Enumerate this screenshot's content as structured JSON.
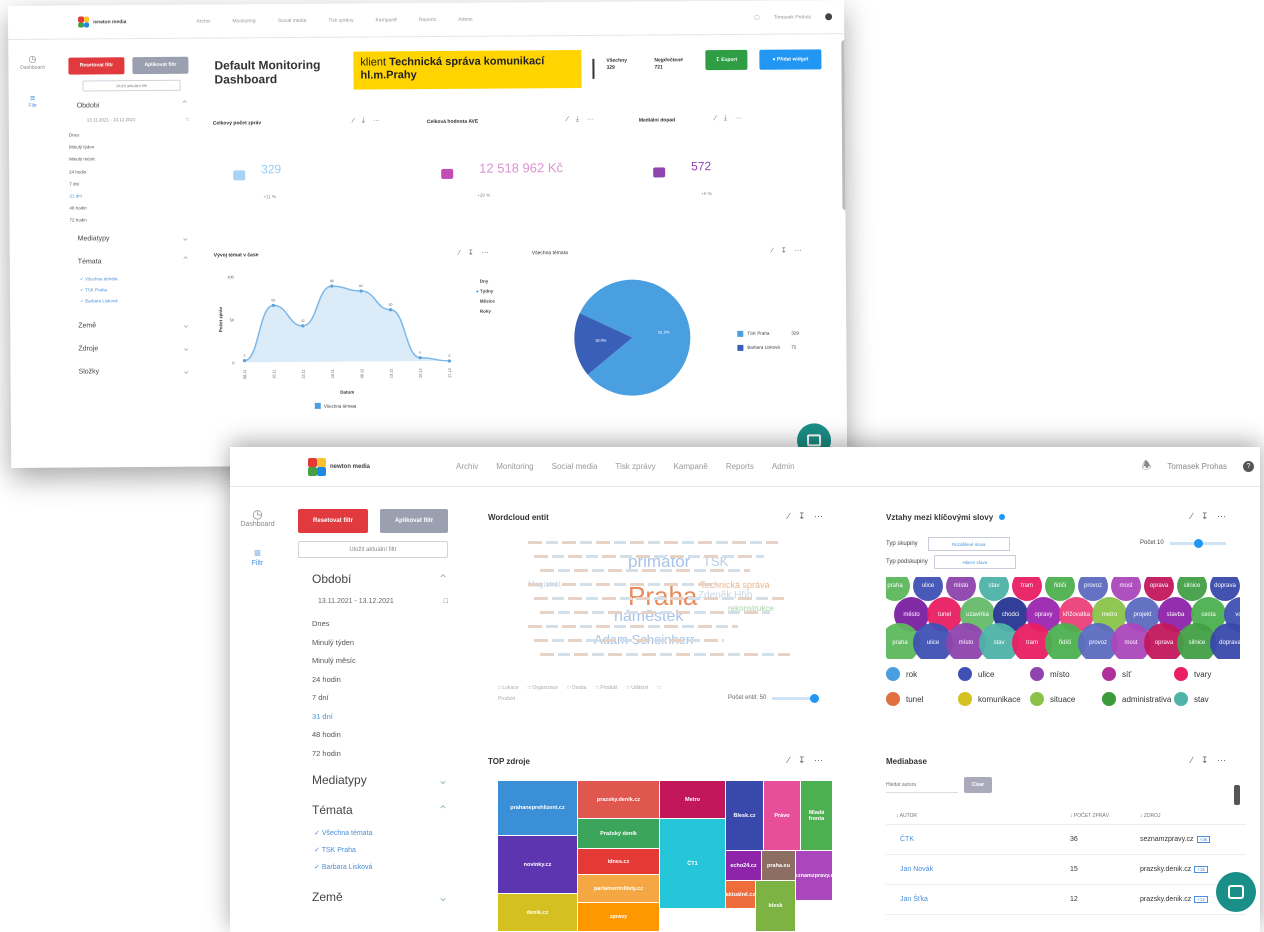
{
  "colors": {
    "accent": "#2196f3",
    "red": "#e03a3e",
    "green": "#2e9d44",
    "banner": "#ffd400",
    "teal": "#1a8f87"
  },
  "app": {
    "logo_text": "newton media",
    "nav": [
      "Archiv",
      "Monitoring",
      "Social media",
      "Tisk zprávy",
      "Kampaně",
      "Reports",
      "Admin"
    ],
    "user": "Tomasek Prohas",
    "settings_icon": "gear-icon",
    "bell_icon": "bell-icon"
  },
  "sidebar": {
    "dashboard_label": "Dashboard",
    "filter_label": "Filtr",
    "reset_filter": "Resetovat filtr",
    "apply_filter": "Aplikovat filtr",
    "save_filter": "Uložit aktuální filtr",
    "period_label": "Období",
    "date_range": "13.11.2021 - 13.12.2021",
    "period_options": [
      "Dnes",
      "Minulý týden",
      "Minulý měsíc",
      "24 hodin",
      "7 dní",
      "31 dní",
      "48 hodin",
      "72 hodin"
    ],
    "mediatypes": "Mediatypy",
    "topics_label": "Témata",
    "topics": [
      "Všechna témata",
      "TSK Praha",
      "Barbara Lisková"
    ],
    "countries": "Země",
    "sources": "Zdroje",
    "folders": "Složky"
  },
  "dashboard": {
    "title": "Default Monitoring Dashboard",
    "client_prefix": "klient",
    "client_name": "Technická správa komunikací hl.m.Prahy",
    "stat_all_label": "Všechny",
    "stat_all_value": "329",
    "stat_relevant_label": "Nejpřečtené",
    "stat_relevant_value": "721",
    "export_btn": "Export",
    "new_widget_btn": "Přidat widget"
  },
  "kpis": [
    {
      "title": "Celkový počet zpráv",
      "value": "329",
      "sub": "+11 %",
      "icon": "document-icon",
      "color": "#4fa9e6"
    },
    {
      "title": "Celková hodnota AVE",
      "value": "12 518 962 Kč",
      "sub": "+20 %",
      "icon": "wallet-icon",
      "color": "#c44bb4"
    },
    {
      "title": "Mediální dopad",
      "value": "572",
      "sub": "+8 %",
      "icon": "briefcase-icon",
      "color": "#8e44ad"
    }
  ],
  "trend_chart": {
    "title": "Vývoj témat v čase",
    "legend_options": [
      "Dny",
      "Týdny",
      "Měsíce",
      "Roky"
    ],
    "selected_option": "Týdny",
    "chart_data": {
      "type": "area",
      "title": "Vývoj témat v čase",
      "xlabel": "Datum",
      "ylabel": "Počet zpráv",
      "categories": [
        "08.11",
        "15.11",
        "22.11",
        "29.11",
        "06.12",
        "13.12",
        "20.12",
        "27.12"
      ],
      "series": [
        {
          "name": "Všechna témata",
          "values": [
            2,
            66,
            42,
            88,
            82,
            60,
            4,
            0
          ]
        }
      ],
      "ylim": [
        0,
        100
      ]
    }
  },
  "pie_chart": {
    "title": "Všechna témata",
    "chart_data": {
      "type": "pie",
      "title": "Všechna témata",
      "categories": [
        "TSK Praha",
        "Barbara Lisková"
      ],
      "values": [
        329,
        72
      ],
      "labels": [
        "81.9%",
        "18.0%"
      ]
    },
    "legend_values": [
      "329",
      "72"
    ]
  },
  "wordcloud": {
    "title": "Wordcloud entit",
    "words": [
      {
        "text": "Praha",
        "size": 26,
        "color": "#e88a5c"
      },
      {
        "text": "primátor",
        "size": 17,
        "color": "#a7c4e8"
      },
      {
        "text": "náměstek",
        "size": 16,
        "color": "#a7c4e8"
      },
      {
        "text": "Adam Scheinherr",
        "size": 13,
        "color": "#a7c4e8"
      },
      {
        "text": "TSK",
        "size": 13,
        "color": "#b8cde8"
      },
      {
        "text": "Zdeněk Hřib",
        "size": 10,
        "color": "#c8d6e6"
      },
      {
        "text": "Technická správa",
        "size": 9,
        "color": "#e8b48c"
      },
      {
        "text": "Magistrát",
        "size": 8,
        "color": "#c8d6e6"
      },
      {
        "text": "rekonstrukce",
        "size": 8,
        "color": "#a8d3a8"
      }
    ],
    "filters": [
      "Lokace",
      "Organizace",
      "Osoba",
      "Produkt",
      "Událost",
      "Produkt"
    ],
    "count_label": "Počet entit: 50"
  },
  "relations": {
    "title": "Vztahy mezi klíčovými slovy",
    "group_label": "Typ skupiny",
    "group_value": "Rozdělené slova",
    "subgroup_label": "Typ podskupiny",
    "subgroup_value": "Hlavní slova",
    "count_label": "Počet 10",
    "bubbles": [
      {
        "label": "praha",
        "color": "#5cb85c"
      },
      {
        "label": "ulice",
        "color": "#3f51b5"
      },
      {
        "label": "místo",
        "color": "#8e44ad"
      },
      {
        "label": "stav",
        "color": "#4fb3a8"
      },
      {
        "label": "tram",
        "color": "#e91e63"
      },
      {
        "label": "řidiči",
        "color": "#4caf50"
      },
      {
        "label": "provoz",
        "color": "#5c6bc0"
      },
      {
        "label": "most",
        "color": "#ab47bc"
      },
      {
        "label": "oprava",
        "color": "#c2185b"
      },
      {
        "label": "silnice",
        "color": "#43a047"
      },
      {
        "label": "doprava",
        "color": "#3949ab"
      },
      {
        "label": "město",
        "color": "#7b1fa2"
      },
      {
        "label": "tunel",
        "color": "#e91e63"
      },
      {
        "label": "uzavírka",
        "color": "#66bb6a"
      },
      {
        "label": "chodci",
        "color": "#283593"
      },
      {
        "label": "opravy",
        "color": "#9c27b0"
      },
      {
        "label": "křižovatka",
        "color": "#ec407a"
      },
      {
        "label": "metro",
        "color": "#8bc34a"
      },
      {
        "label": "projekt",
        "color": "#5c6bc0"
      },
      {
        "label": "stavba",
        "color": "#8e24aa"
      },
      {
        "label": "cesta",
        "color": "#4caf50"
      },
      {
        "label": "vozy",
        "color": "#3f51b5"
      }
    ],
    "legend": [
      {
        "label": "rok",
        "color": "#4a9fe0"
      },
      {
        "label": "ulice",
        "color": "#3f51b5"
      },
      {
        "label": "místo",
        "color": "#8e44ad"
      },
      {
        "label": "síť",
        "color": "#b0309a"
      },
      {
        "label": "tvary",
        "color": "#e91e63"
      },
      {
        "label": "tunel",
        "color": "#e07040"
      },
      {
        "label": "komunikace",
        "color": "#d4c020"
      },
      {
        "label": "situace",
        "color": "#8bc34a"
      },
      {
        "label": "administrativa",
        "color": "#3b9b3b"
      },
      {
        "label": "stav",
        "color": "#4fb3a8"
      }
    ]
  },
  "top_sources": {
    "title": "TOP zdroje",
    "tiles": [
      {
        "label": "prahaneprehlizeni.cz",
        "color": "#3a8fd6"
      },
      {
        "label": "prazsky.denik.cz",
        "color": "#e0574f"
      },
      {
        "label": "Metro",
        "color": "#c2185b"
      },
      {
        "label": "Pražský deník",
        "color": "#3ca55c"
      },
      {
        "label": "Blesk.cz",
        "color": "#3949ab"
      },
      {
        "label": "Právo",
        "color": "#e84f9a"
      },
      {
        "label": "Mladá fronta",
        "color": "#4caf50"
      },
      {
        "label": "novinky.cz",
        "color": "#5e35b1"
      },
      {
        "label": "echo24.cz",
        "color": "#8e24aa"
      },
      {
        "label": "idnes.cz",
        "color": "#e53935"
      },
      {
        "label": "praha.eu",
        "color": "#8d6e63"
      },
      {
        "label": "ČT1",
        "color": "#26c6da"
      },
      {
        "label": "parlamentnilisty.cz",
        "color": "#f4a742"
      },
      {
        "label": "aktuálně.cz",
        "color": "#ef6c3c"
      },
      {
        "label": "seznamzpravy.cz",
        "color": "#ab47bc"
      },
      {
        "label": "denik.cz",
        "color": "#d4c020"
      },
      {
        "label": "blesk",
        "color": "#7cb342"
      },
      {
        "label": "zpravy",
        "color": "#ff9800"
      }
    ]
  },
  "mediabase": {
    "title": "Mediabase",
    "search_placeholder": "Hledat autora",
    "clear_btn": "Clear",
    "col_author": "AUTOR",
    "col_count": "POČET ZPRÁV",
    "col_source": "ZDROJ",
    "rows": [
      {
        "author": "ČTK",
        "count": "36",
        "source": "seznamzpravy.cz",
        "badge": "+36"
      },
      {
        "author": "Jan Novák",
        "count": "15",
        "source": "prazsky.denik.cz",
        "badge": "+15"
      },
      {
        "author": "Jan Šťka",
        "count": "12",
        "source": "prazsky.denik.cz",
        "badge": "+12"
      }
    ]
  }
}
